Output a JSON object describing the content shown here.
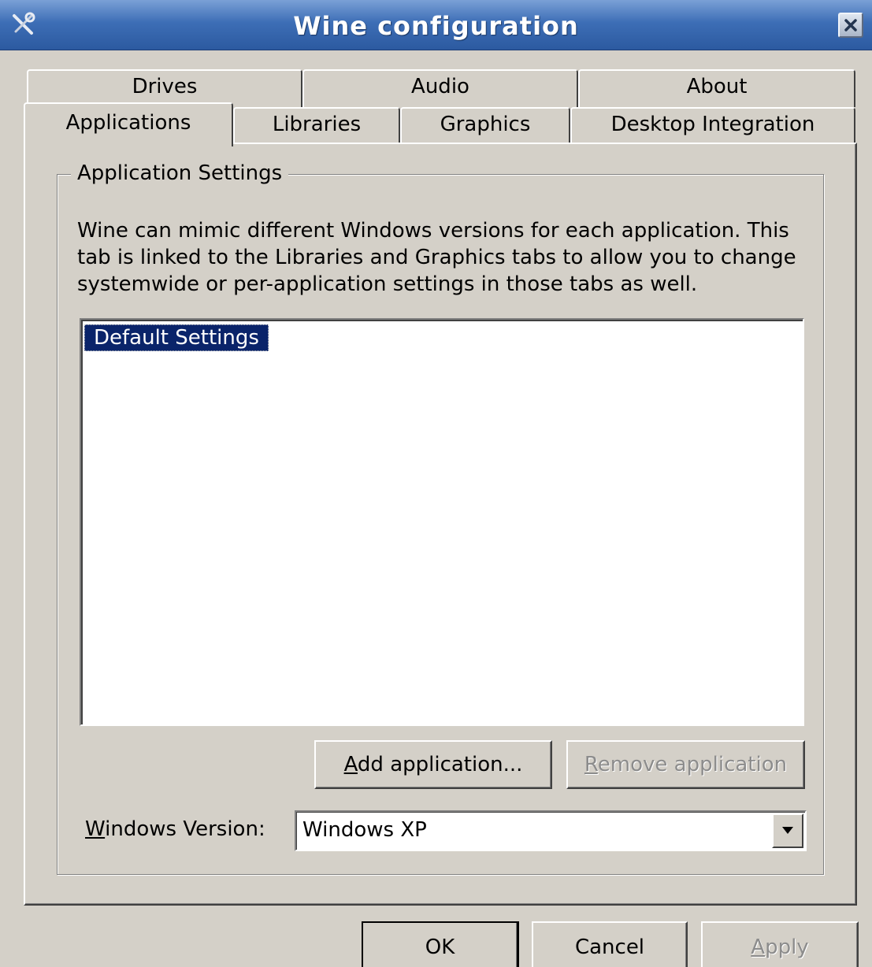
{
  "window": {
    "title": "Wine configuration",
    "app_icon": "tools-icon",
    "close_icon": "close-icon"
  },
  "tabs": {
    "row_back": [
      {
        "label": "Drives"
      },
      {
        "label": "Audio"
      },
      {
        "label": "About"
      }
    ],
    "row_front": [
      {
        "label": "Applications",
        "selected": true
      },
      {
        "label": "Libraries"
      },
      {
        "label": "Graphics"
      },
      {
        "label": "Desktop Integration"
      }
    ]
  },
  "app_settings": {
    "group_label": "Application Settings",
    "description": "Wine can mimic different Windows versions for each application.  This tab is linked to the Libraries and Graphics tabs to allow you to change systemwide or per-application settings in those tabs as well.",
    "applications": [
      {
        "label": "Default Settings",
        "selected": true
      }
    ],
    "add_button": {
      "prefix": "",
      "mnemonic": "A",
      "rest": "dd application..."
    },
    "remove_button": {
      "prefix": "",
      "mnemonic": "R",
      "rest": "emove application",
      "enabled": false
    },
    "version_label": {
      "mnemonic": "W",
      "rest": "indows Version:"
    },
    "version_value": "Windows XP",
    "dropdown_icon": "chevron-down-icon"
  },
  "footer": {
    "ok_label": "OK",
    "cancel_label": "Cancel",
    "apply": {
      "mnemonic": "A",
      "rest": "pply",
      "enabled": false
    }
  }
}
